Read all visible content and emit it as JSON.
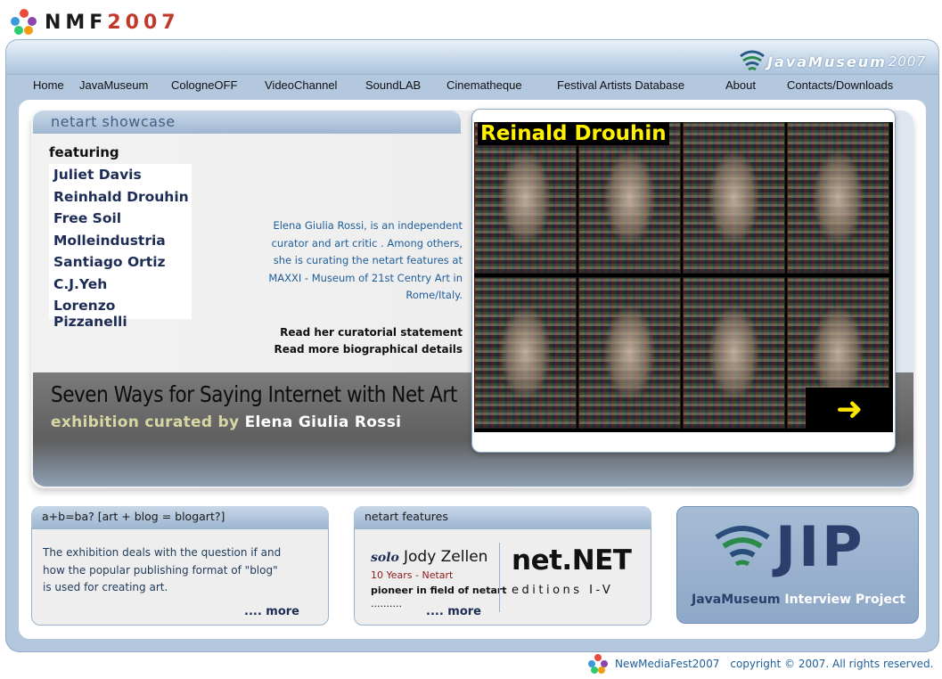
{
  "logo": {
    "nmf": "NMF",
    "year": "2007"
  },
  "header": {
    "brand": "JavaMuseum",
    "brand_year": "2007"
  },
  "nav": [
    "Home",
    "JavaMuseum",
    "CologneOFF",
    "VideoChannel",
    "SoundLAB",
    "Cinematheque",
    "Festival Artists Database",
    "About",
    "Contacts/Downloads"
  ],
  "showcase": {
    "tab_title": "netart showcase",
    "featuring": "featuring",
    "artists": [
      "Juliet Davis",
      "Reinhald Drouhin",
      "Free Soil",
      "Molleindustria",
      "Santiago Ortiz",
      "C.J.Yeh",
      "Lorenzo Pizzanelli"
    ],
    "bio_lines": [
      "Elena Giulia Rossi, is an independent",
      "curator and art critic . Among others,",
      "she is curating the netart features at",
      "MAXXI - Museum of 21st Centry Art in",
      "Rome/Italy."
    ],
    "link_statement": "Read her curatorial statement",
    "link_bio": "Read more biographical details",
    "exhibition_title": "Seven Ways for Saying Internet with Net Art",
    "curated_by": "exhibition curated by",
    "curator": "Elena Giulia Rossi",
    "featured_name": "Reinald Drouhin",
    "arrow": "➜"
  },
  "blog_panel": {
    "title": "a+b=ba? [art + blog = blogart?]",
    "lines": [
      "The exhibition deals with the question if and",
      "how the popular publishing format of \"blog\"",
      "is used for creating art."
    ],
    "more": ".... more"
  },
  "netart_panel": {
    "title": "netart features",
    "solo": "solo",
    "artist": "Jody Zellen",
    "tagline": "10 Years - Netart",
    "desc": "pioneer in field of netart",
    "dots": "..........",
    "more": ".... more",
    "netnet": "net.NET",
    "editions": "editions I-V"
  },
  "jip_panel": {
    "letters": "JIP",
    "caption_a": "JavaMuseum",
    "caption_b": "Interview Project"
  },
  "footer": {
    "brand": "NewMediaFest2007",
    "copyright": "copyright © 2007. All rights reserved."
  },
  "colors": {
    "accent_red": "#c0392b",
    "link_blue": "#1e5d99",
    "frame_blue": "#b3c8df",
    "name_yellow": "#fff200"
  }
}
